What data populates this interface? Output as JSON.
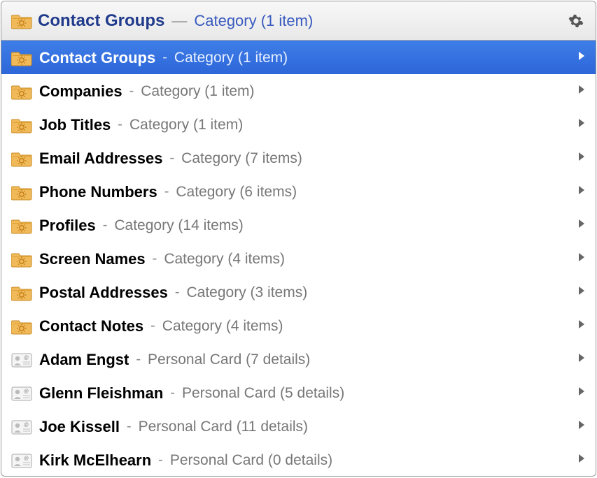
{
  "header": {
    "title": "Contact Groups",
    "separator": "—",
    "subtitle": "Category (1 item)"
  },
  "rows": [
    {
      "icon": "folder",
      "name": "Contact Groups",
      "sep": "-",
      "meta": "Category (1 item)",
      "selected": true
    },
    {
      "icon": "folder",
      "name": "Companies",
      "sep": "-",
      "meta": "Category (1 item)",
      "selected": false
    },
    {
      "icon": "folder",
      "name": "Job Titles",
      "sep": "-",
      "meta": "Category (1 item)",
      "selected": false
    },
    {
      "icon": "folder",
      "name": "Email Addresses",
      "sep": "-",
      "meta": "Category (7 items)",
      "selected": false
    },
    {
      "icon": "folder",
      "name": "Phone Numbers",
      "sep": "-",
      "meta": "Category (6 items)",
      "selected": false
    },
    {
      "icon": "folder",
      "name": "Profiles",
      "sep": "-",
      "meta": "Category (14 items)",
      "selected": false
    },
    {
      "icon": "folder",
      "name": "Screen Names",
      "sep": "-",
      "meta": "Category (4 items)",
      "selected": false
    },
    {
      "icon": "folder",
      "name": "Postal Addresses",
      "sep": "-",
      "meta": "Category (3 items)",
      "selected": false
    },
    {
      "icon": "folder",
      "name": "Contact Notes",
      "sep": "-",
      "meta": "Category (4 items)",
      "selected": false
    },
    {
      "icon": "card",
      "name": "Adam Engst",
      "sep": "-",
      "meta": "Personal Card (7 details)",
      "selected": false
    },
    {
      "icon": "card",
      "name": "Glenn Fleishman",
      "sep": "-",
      "meta": "Personal Card (5 details)",
      "selected": false
    },
    {
      "icon": "card",
      "name": "Joe Kissell",
      "sep": "-",
      "meta": "Personal Card (11 details)",
      "selected": false
    },
    {
      "icon": "card",
      "name": "Kirk McElhearn",
      "sep": "-",
      "meta": "Personal Card (0 details)",
      "selected": false
    }
  ]
}
